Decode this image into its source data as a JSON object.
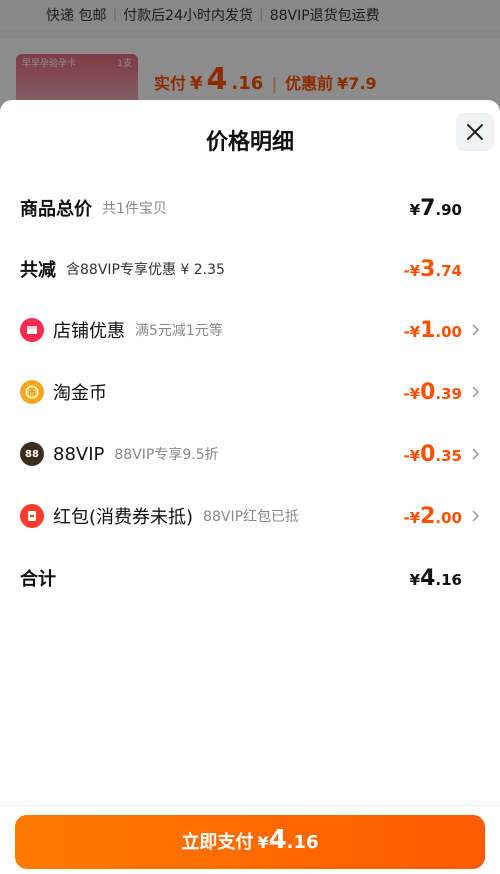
{
  "background": {
    "shipping_line": [
      "快递 包邮",
      "付款后24小时内发货",
      "88VIP退货包运费"
    ],
    "product_thumb_label": "早早孕验孕卡",
    "product_thumb_badge": "1支",
    "price_label": "实付",
    "price_currency": "¥",
    "price_int": "4",
    "price_dec": ".16",
    "original_label": "优惠前",
    "original_price": "¥7.9"
  },
  "sheet": {
    "title": "价格明细",
    "close_icon": "close-icon"
  },
  "rows": {
    "subtotal": {
      "label": "商品总价",
      "desc": "共1件宝贝",
      "prefix": "¥",
      "int": "7",
      "dec": ".90"
    },
    "reduction": {
      "label": "共减",
      "desc": "含88VIP专享优惠 ¥ 2.35",
      "prefix": "-¥",
      "int": "3",
      "dec": ".74"
    },
    "shop": {
      "label": "店铺优惠",
      "desc": "满5元减1元等",
      "prefix": "-¥",
      "int": "1",
      "dec": ".00",
      "icon": "shop-coupon-icon"
    },
    "coin": {
      "label": "淘金币",
      "desc": "",
      "prefix": "-¥",
      "int": "0",
      "dec": ".39",
      "icon": "gold-coin-icon"
    },
    "vip": {
      "label": "88VIP",
      "desc": "88VIP专享9.5折",
      "prefix": "-¥",
      "int": "0",
      "dec": ".35",
      "icon_text": "88"
    },
    "hongbao": {
      "label": "红包(消费券未抵)",
      "desc": "88VIP红包已抵",
      "prefix": "-¥",
      "int": "2",
      "dec": ".00",
      "icon": "red-envelope-icon"
    },
    "total": {
      "label": "合计",
      "prefix": "¥",
      "int": "4",
      "dec": ".16"
    }
  },
  "pay_button": {
    "label": "立即支付",
    "currency": "¥",
    "int": "4",
    "dec": ".16"
  },
  "colors": {
    "accent": "#ff5000",
    "button_start": "#ff7b00",
    "button_end": "#ff5a00"
  }
}
